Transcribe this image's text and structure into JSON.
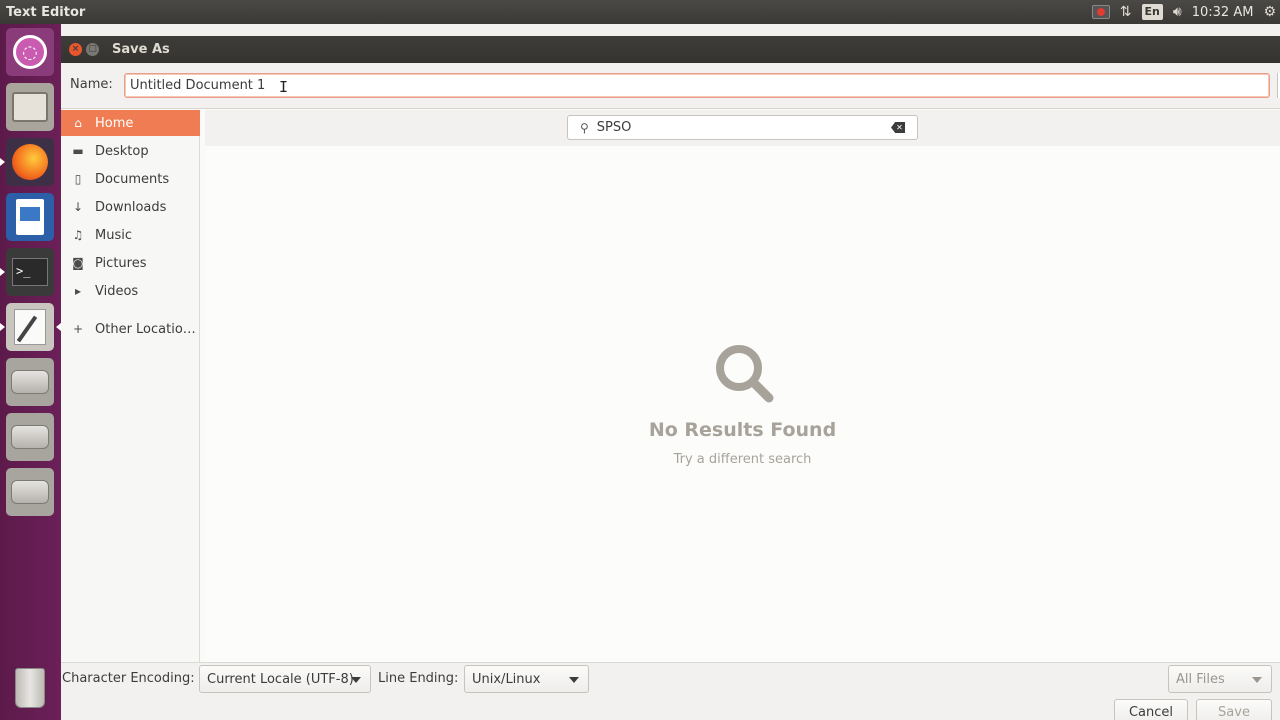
{
  "top_panel": {
    "app_title": "Text Editor",
    "keyboard_layout": "En",
    "clock": "10:32 AM"
  },
  "launcher": {
    "items": [
      "Ubuntu",
      "Files",
      "Firefox",
      "LibreOffice Writer",
      "Terminal",
      "Text Editor",
      "Drive",
      "Drive",
      "Drive",
      "Trash"
    ]
  },
  "dialog": {
    "title": "Save As",
    "name_label": "Name:",
    "name_value": "Untitled Document 1",
    "search_query": "SPSO",
    "sidebar": {
      "items": [
        {
          "label": "Home",
          "icon": "home-icon",
          "active": true
        },
        {
          "label": "Desktop",
          "icon": "folder-icon"
        },
        {
          "label": "Documents",
          "icon": "document-icon"
        },
        {
          "label": "Downloads",
          "icon": "download-icon"
        },
        {
          "label": "Music",
          "icon": "music-icon"
        },
        {
          "label": "Pictures",
          "icon": "camera-icon"
        },
        {
          "label": "Videos",
          "icon": "video-icon"
        },
        {
          "label": "Other Locatio…",
          "icon": "plus-icon"
        }
      ]
    },
    "empty_state": {
      "title": "No Results Found",
      "subtitle": "Try a different search"
    },
    "bottom": {
      "encoding_label": "Character Encoding:",
      "encoding_value": "Current Locale (UTF-8)",
      "line_ending_label": "Line Ending:",
      "line_ending_value": "Unix/Linux",
      "filter_value": "All Files",
      "cancel_label": "Cancel",
      "save_label": "Save"
    }
  },
  "colors": {
    "accent": "#ef7c53",
    "launcher": "#6b2058",
    "titlebar": "#3e3d39",
    "muted_text": "#a8a39a"
  }
}
